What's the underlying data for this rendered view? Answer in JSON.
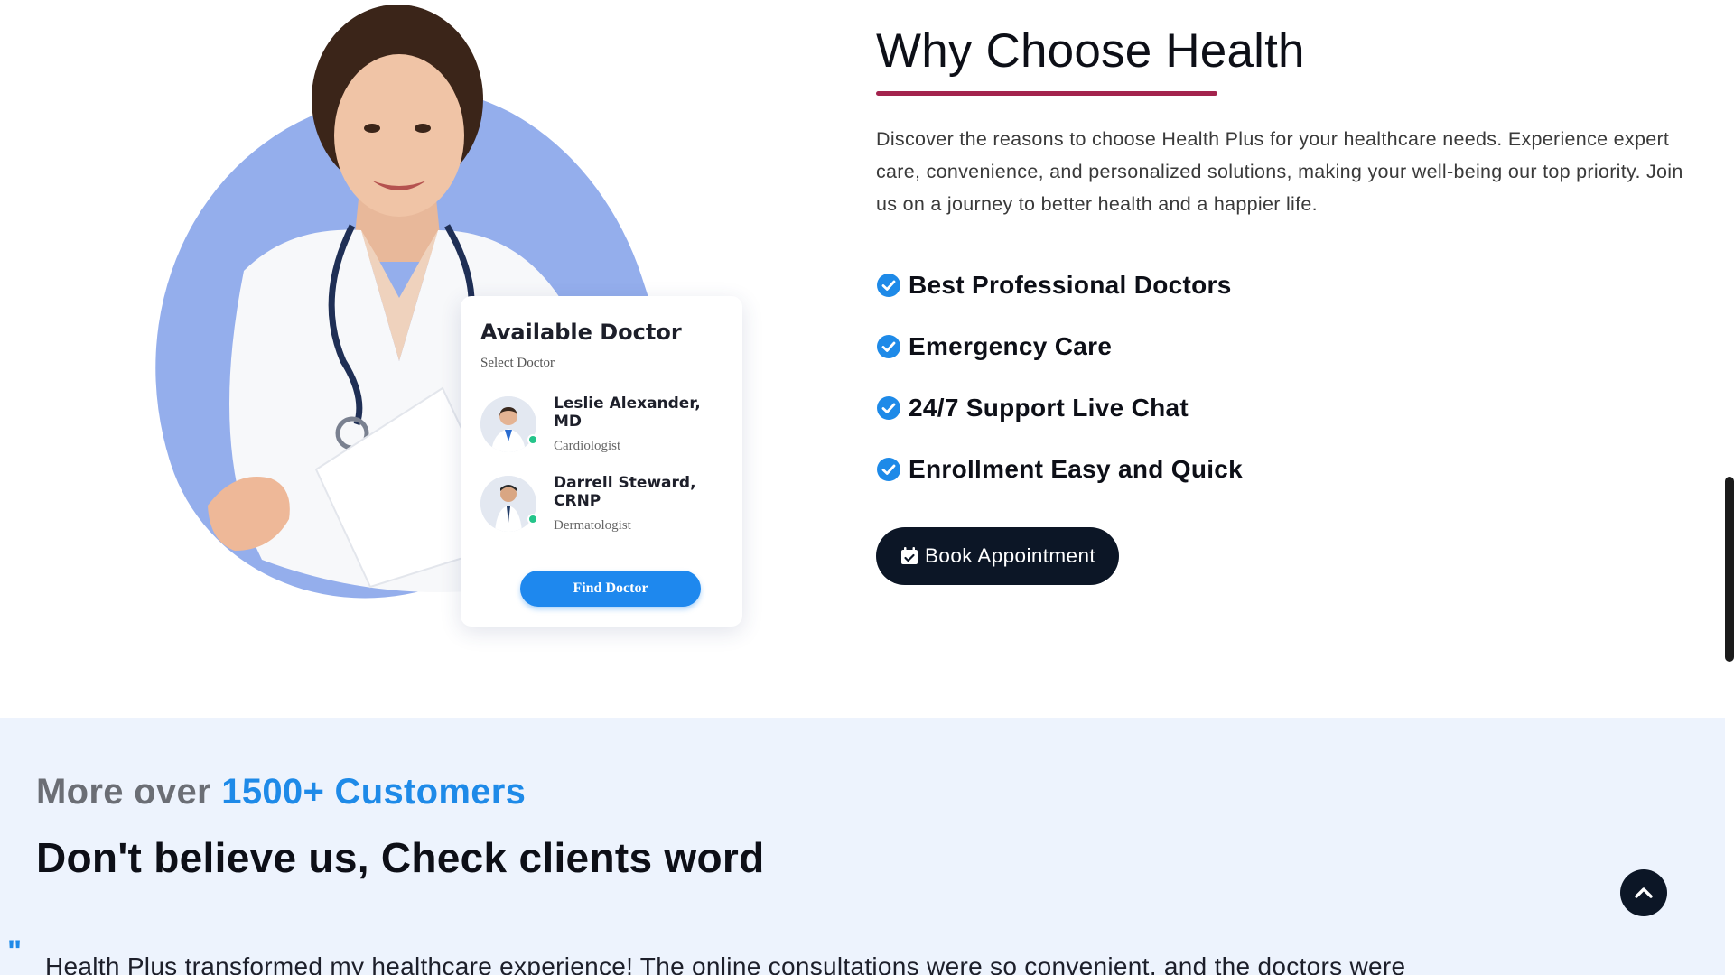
{
  "card": {
    "title": "Available Doctor",
    "subtitle": "Select Doctor",
    "doctors": [
      {
        "name": "Leslie Alexander, MD",
        "role": "Cardiologist"
      },
      {
        "name": "Darrell Steward, CRNP",
        "role": "Dermatologist"
      }
    ],
    "find_button": "Find Doctor"
  },
  "why": {
    "title": "Why Choose Health",
    "description": "Discover the reasons to choose Health Plus for your healthcare needs. Experience expert care, convenience, and personalized solutions, making your well-being our top priority. Join us on a journey to better health and a happier life.",
    "features": [
      "Best Professional Doctors",
      "Emergency Care",
      "24/7 Support Live Chat",
      "Enrollment Easy and Quick"
    ],
    "book_button": "Book Appointment",
    "underline_color": "#a3234d"
  },
  "testimonials": {
    "lead": "More over",
    "highlight": "1500+ Customers",
    "heading": "Don't believe us, Check clients word",
    "quote_mark": "\"",
    "quote": "Health Plus transformed my healthcare experience! The online consultations were so convenient, and the doctors were"
  },
  "icons": {
    "check": "check-circle-icon",
    "calendar": "calendar-check-icon",
    "back_to_top": "chevron-up-icon"
  },
  "colors": {
    "accent_blue": "#1e8ae8",
    "dark": "#0c1626",
    "section_bg": "#edf3fd",
    "blob": "#94aeec"
  }
}
